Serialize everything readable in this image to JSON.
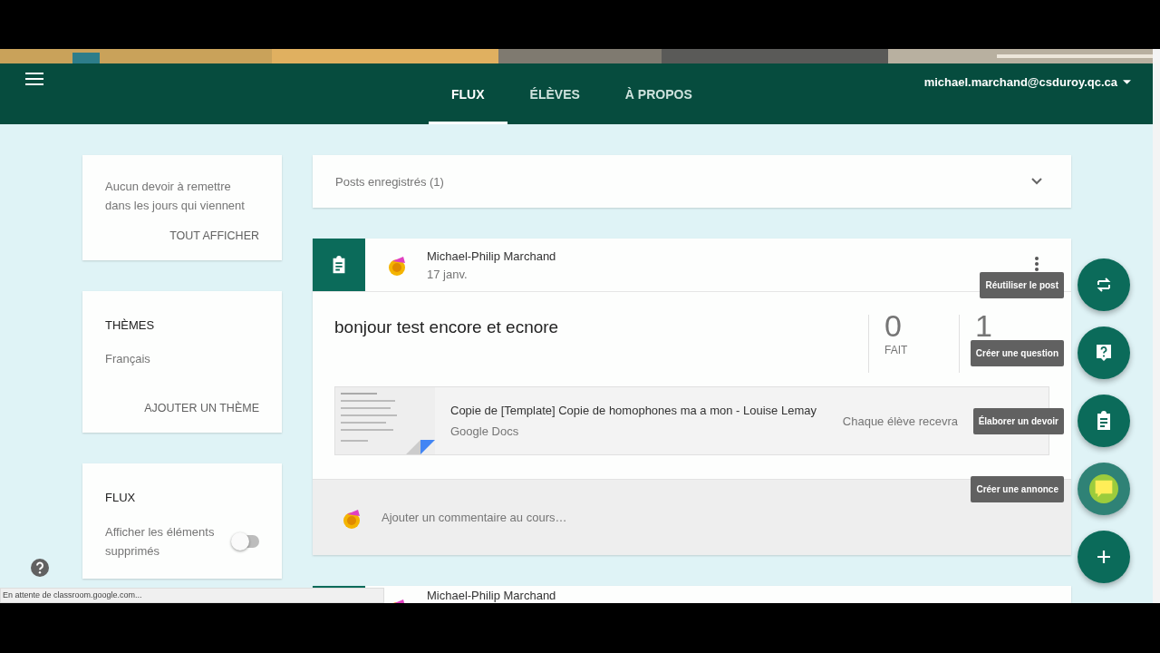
{
  "header": {
    "tabs": [
      {
        "label": "FLUX",
        "selected": true
      },
      {
        "label": "ÉLÈVES",
        "selected": false
      },
      {
        "label": "À PROPOS",
        "selected": false
      }
    ],
    "account": "michael.marchand@csduroy.qc.ca"
  },
  "sidebar": {
    "upcoming": {
      "text": "Aucun devoir à remettre dans les jours qui viennent",
      "link": "TOUT AFFICHER"
    },
    "themes": {
      "title": "THÈMES",
      "items": [
        "Français"
      ],
      "link": "AJOUTER UN THÈME"
    },
    "stream": {
      "title": "FLUX",
      "toggle_label": "Afficher les éléments supprimés",
      "on": false
    }
  },
  "saved_posts": "Posts enregistrés (1)",
  "posts": [
    {
      "author": "Michael-Philip Marchand",
      "date": "17 janv.",
      "title": "bonjour test encore et ecnore",
      "stats": [
        {
          "value": "0",
          "label": "FAIT"
        },
        {
          "value": "1"
        }
      ],
      "attachment": {
        "title": "Copie de [Template] Copie de homophones ma a mon - Louise Lemay",
        "type": "Google Docs",
        "note": "Chaque élève recevra"
      },
      "comment_placeholder": "Ajouter un commentaire au cours…"
    },
    {
      "author": "Michael-Philip Marchand"
    }
  ],
  "fab_menu": [
    {
      "kind": "reuse",
      "tooltip": "Réutiliser le post",
      "highlighted": false
    },
    {
      "kind": "question",
      "tooltip": "Créer une question",
      "highlighted": false
    },
    {
      "kind": "assignment",
      "tooltip": "Élaborer un devoir",
      "highlighted": false
    },
    {
      "kind": "announcement",
      "tooltip": "Créer une annonce",
      "highlighted": true
    },
    {
      "kind": "add",
      "highlighted": false
    }
  ],
  "status_bar": "En attente de classroom.google.com..."
}
